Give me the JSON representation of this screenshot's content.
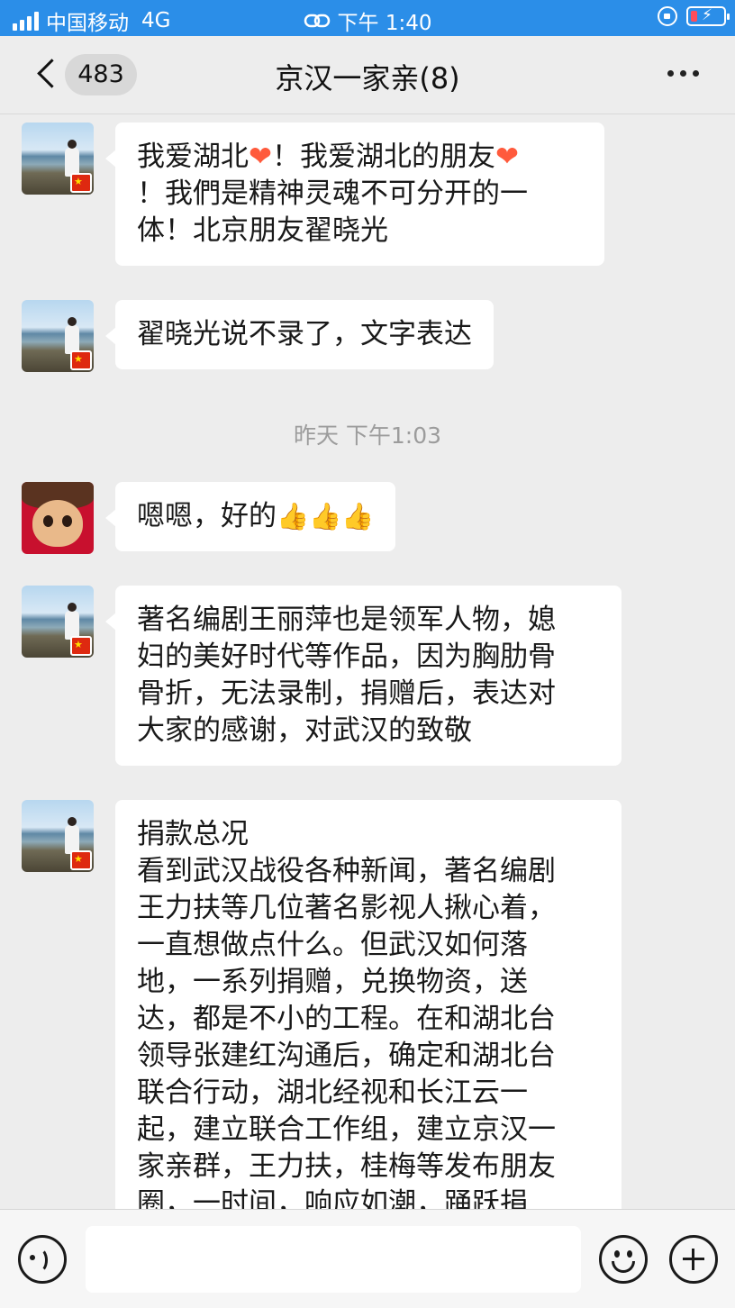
{
  "status_bar": {
    "carrier": "中国移动",
    "network": "4G",
    "time": "下午 1:40"
  },
  "nav": {
    "unread_count": "483",
    "title": "京汉一家亲(8)"
  },
  "messages": [
    {
      "sender_avatar": "beach-photo-avatar",
      "parts": [
        "我爱湖北",
        "！我爱湖北的朋友",
        "\n！我們是精神灵魂不可分开的一\n体！北京朋友翟晓光"
      ],
      "emoji": "❤"
    },
    {
      "sender_avatar": "beach-photo-avatar",
      "text": "翟晓光说不录了，文字表达"
    },
    {
      "sender_avatar": "monkey-doll-avatar",
      "text": "嗯嗯，好的",
      "emoji": "👍👍👍"
    },
    {
      "sender_avatar": "beach-photo-avatar",
      "text": "著名编剧王丽萍也是领军人物，媳\n妇的美好时代等作品，因为胸肋骨\n骨折，无法录制，捐赠后，表达对\n大家的感谢，对武汉的致敬"
    },
    {
      "sender_avatar": "beach-photo-avatar",
      "text": "捐款总况\n看到武汉战役各种新闻，著名编剧\n王力扶等几位著名影视人揪心着，\n一直想做点什么。但武汉如何落\n地，一系列捐赠，兑换物资，送\n达，都是不小的工程。在和湖北台\n领导张建红沟通后，确定和湖北台\n联合行动，湖北经视和长江云一\n起，建立联合工作组，建立京汉一\n家亲群，王力扶，桂梅等发布朋友\n圈，一时间，响应如潮，踊跃捐"
    }
  ],
  "timestamp": "昨天 下午1:03",
  "input": {
    "value": ""
  }
}
